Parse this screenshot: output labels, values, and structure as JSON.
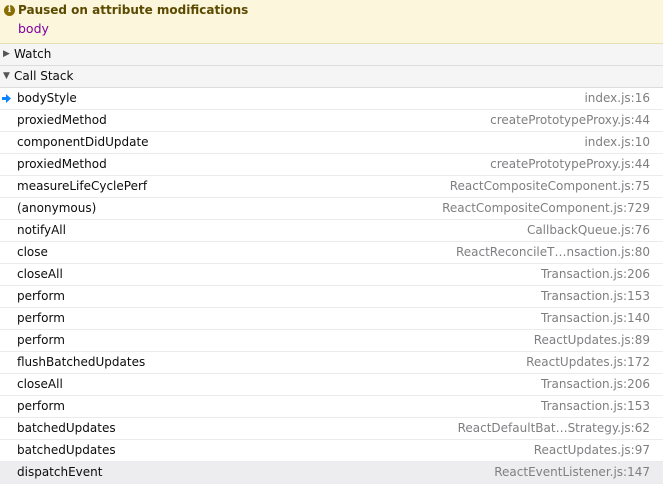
{
  "paused": {
    "title": "Paused on attribute modifications",
    "target": "body",
    "icon": "info-icon"
  },
  "sections": {
    "watch": {
      "label": "Watch",
      "expanded": false
    },
    "call_stack": {
      "label": "Call Stack",
      "expanded": true
    }
  },
  "call_stack": [
    {
      "fn": "bodyStyle",
      "loc": "index.js:16",
      "current": true
    },
    {
      "fn": "proxiedMethod",
      "loc": "createPrototypeProxy.js:44"
    },
    {
      "fn": "componentDidUpdate",
      "loc": "index.js:10"
    },
    {
      "fn": "proxiedMethod",
      "loc": "createPrototypeProxy.js:44"
    },
    {
      "fn": "measureLifeCyclePerf",
      "loc": "ReactCompositeComponent.js:75"
    },
    {
      "fn": "(anonymous)",
      "loc": "ReactCompositeComponent.js:729"
    },
    {
      "fn": "notifyAll",
      "loc": "CallbackQueue.js:76"
    },
    {
      "fn": "close",
      "loc": "ReactReconcileT…nsaction.js:80"
    },
    {
      "fn": "closeAll",
      "loc": "Transaction.js:206"
    },
    {
      "fn": "perform",
      "loc": "Transaction.js:153"
    },
    {
      "fn": "perform",
      "loc": "Transaction.js:140"
    },
    {
      "fn": "perform",
      "loc": "ReactUpdates.js:89"
    },
    {
      "fn": "flushBatchedUpdates",
      "loc": "ReactUpdates.js:172"
    },
    {
      "fn": "closeAll",
      "loc": "Transaction.js:206"
    },
    {
      "fn": "perform",
      "loc": "Transaction.js:153"
    },
    {
      "fn": "batchedUpdates",
      "loc": "ReactDefaultBat…Strategy.js:62"
    },
    {
      "fn": "batchedUpdates",
      "loc": "ReactUpdates.js:97"
    },
    {
      "fn": "dispatchEvent",
      "loc": "ReactEventListener.js:147",
      "highlighted": true
    }
  ],
  "colors": {
    "pause_bg": "#fbf6dc",
    "pause_text": "#5b4a00",
    "target_text": "#8000a0",
    "current_arrow": "#0a84ff"
  }
}
